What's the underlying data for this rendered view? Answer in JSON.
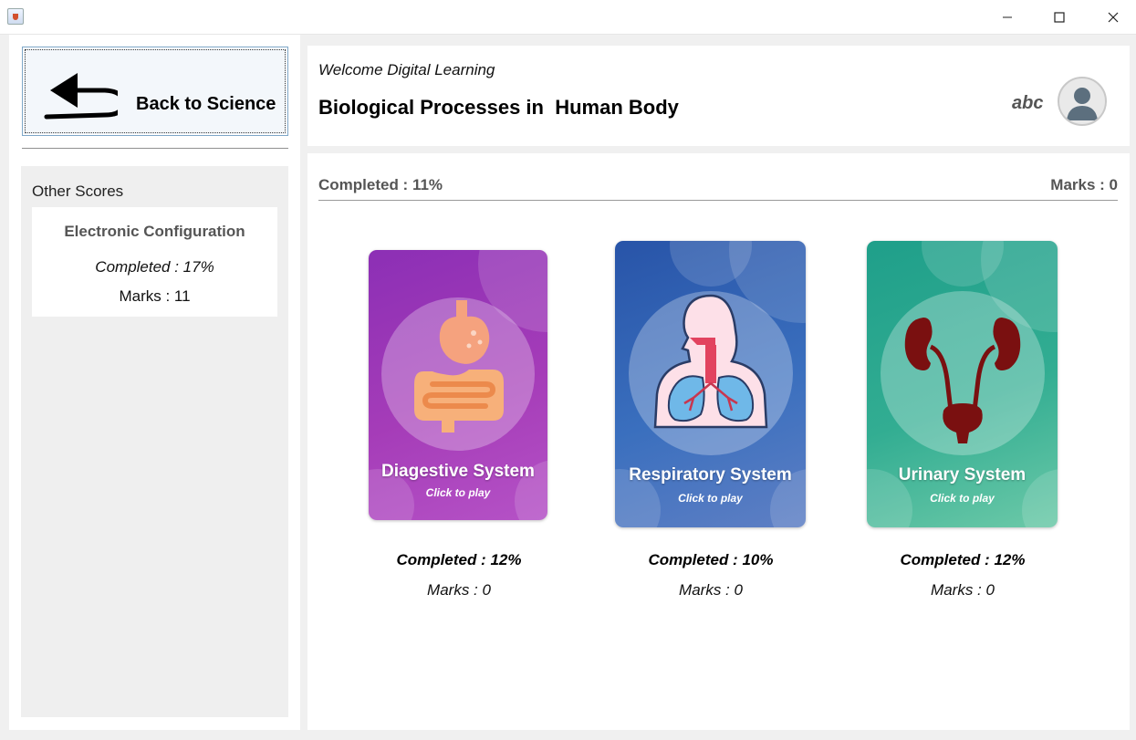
{
  "window": {
    "controls": {
      "minimize_icon": "minimize-icon",
      "maximize_icon": "maximize-icon",
      "close_icon": "close-icon"
    }
  },
  "sidebar": {
    "back_label": "Back to Science",
    "other_scores_title": "Other Scores",
    "scores": [
      {
        "title": "Electronic Configuration",
        "completed": "Completed : 17%",
        "marks": "Marks : 11"
      }
    ]
  },
  "header": {
    "welcome": "Welcome Digital Learning",
    "title": "Biological Processes in  Human Body",
    "username": "abc"
  },
  "summary": {
    "completed": "Completed : 11%",
    "marks": "Marks : 0"
  },
  "topics": [
    {
      "title": "Diagestive System",
      "subtitle": "Click to play",
      "completed": "Completed : 12%",
      "marks": "Marks : 0",
      "color": "#9b36b6"
    },
    {
      "title": "Respiratory System",
      "subtitle": "Click to play",
      "completed": "Completed : 10%",
      "marks": "Marks : 0",
      "color": "#2f60b0"
    },
    {
      "title": "Urinary System",
      "subtitle": "Click to play",
      "completed": "Completed : 12%",
      "marks": "Marks : 0",
      "color": "#27a58e"
    }
  ]
}
